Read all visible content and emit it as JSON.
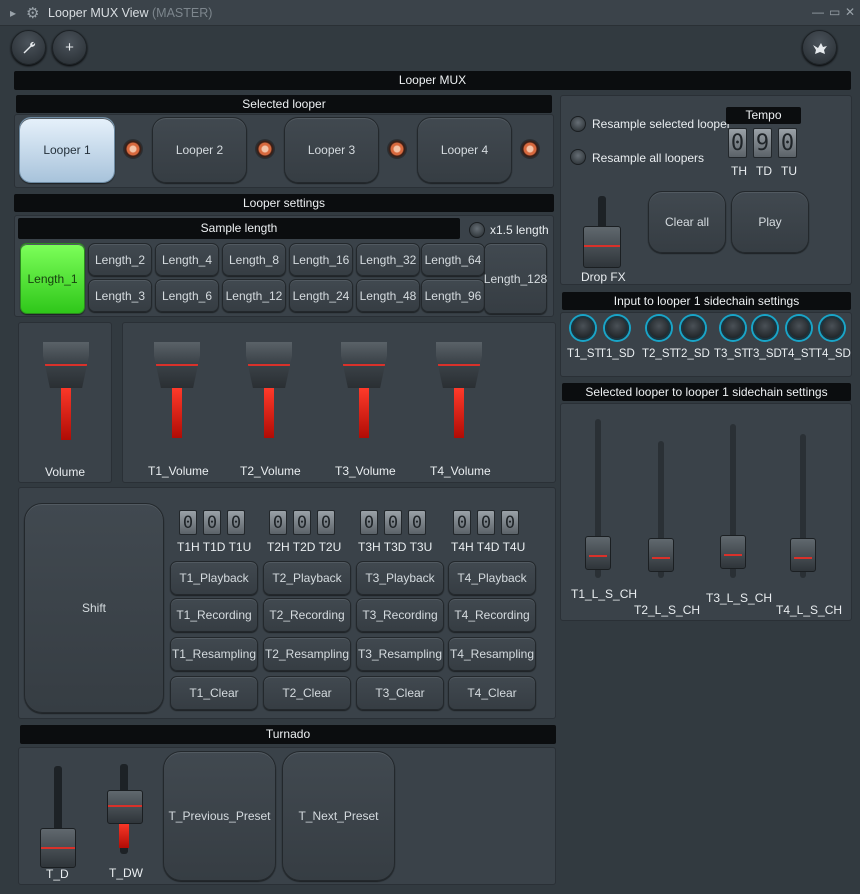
{
  "window": {
    "title": "Looper MUX View",
    "title_suffix": "(MASTER)",
    "controls": {
      "minimize": "—",
      "maximize": "▭",
      "close": "✕"
    }
  },
  "toolbar": {
    "wrench_icon": "wrench-icon",
    "plus_icon": "plus-icon",
    "pegasus_icon": "pegasus-icon"
  },
  "main_header": "Looper MUX",
  "selected_looper": {
    "header": "Selected looper",
    "loopers": [
      "Looper 1",
      "Looper 2",
      "Looper 3",
      "Looper 4"
    ],
    "selected": "Looper 1"
  },
  "looper_settings": {
    "header": "Looper settings",
    "sample_length_header": "Sample length",
    "x15_label": "x1.5 length",
    "lengths_top": [
      "Length_2",
      "Length_4",
      "Length_8",
      "Length_16",
      "Length_32",
      "Length_64"
    ],
    "lengths_bottom": [
      "Length_3",
      "Length_6",
      "Length_12",
      "Length_24",
      "Length_48",
      "Length_96"
    ],
    "length_1": "Length_1",
    "length_128": "Length_128",
    "active_length": "Length_1"
  },
  "volumes": {
    "master_label": "Volume",
    "master_level": 0.55,
    "tracks": [
      {
        "label": "T1_Volume",
        "level": 0.5
      },
      {
        "label": "T2_Volume",
        "level": 0.5
      },
      {
        "label": "T3_Volume",
        "level": 0.5
      },
      {
        "label": "T4_Volume",
        "level": 0.5
      }
    ]
  },
  "track_controls": {
    "shift": "Shift",
    "counters": [
      {
        "digits": [
          "0",
          "0",
          "0"
        ],
        "label": "T1H T1D T1U"
      },
      {
        "digits": [
          "0",
          "0",
          "0"
        ],
        "label": "T2H T2D T2U"
      },
      {
        "digits": [
          "0",
          "0",
          "0"
        ],
        "label": "T3H T3D T3U"
      },
      {
        "digits": [
          "0",
          "0",
          "0"
        ],
        "label": "T4H T4D T4U"
      }
    ],
    "playback": [
      "T1_Playback",
      "T2_Playback",
      "T3_Playback",
      "T4_Playback"
    ],
    "recording": [
      "T1_Recording",
      "T2_Recording",
      "T3_Recording",
      "T4_Recording"
    ],
    "resampling": [
      "T1_Resampling",
      "T2_Resampling",
      "T3_Resampling",
      "T4_Resampling"
    ],
    "clear": [
      "T1_Clear",
      "T2_Clear",
      "T3_Clear",
      "T4_Clear"
    ]
  },
  "turnado": {
    "header": "Turnado",
    "t_d_label": "T_D",
    "t_dw_label": "T_DW",
    "t_dw_level": 0.3,
    "previous_preset": "T_Previous_Preset",
    "next_preset": "T_Next_Preset"
  },
  "resample": {
    "selected_label": "Resample selected looper",
    "all_label": "Resample all loopers",
    "tempo_header": "Tempo",
    "tempo_digits": [
      "0",
      "9",
      "0"
    ],
    "tempo_labels": [
      "TH",
      "TD",
      "TU"
    ],
    "drop_fx": "Drop FX",
    "clear_all": "Clear all",
    "play": "Play"
  },
  "sidechain_input": {
    "header": "Input to looper 1 sidechain settings",
    "knob_labels": [
      "T1_ST",
      "T1_SD",
      "T2_ST",
      "T2_SD",
      "T3_ST",
      "T3_SD",
      "T4_ST",
      "T4_SD"
    ]
  },
  "sidechain_selected": {
    "header": "Selected looper to looper 1 sidechain settings",
    "sliders": [
      {
        "label": "T1_L_S_CH",
        "level": 0.18
      },
      {
        "label": "T2_L_S_CH",
        "level": 0.1
      },
      {
        "label": "T3_L_S_CH",
        "level": 0.2
      },
      {
        "label": "T4_L_S_CH",
        "level": 0.1
      }
    ]
  },
  "colors": {
    "accent_green": "#3fe021",
    "fader_red": "#ff2a1a",
    "knob_ring": "#19a5c8",
    "selected_blue": "#c8dcef"
  }
}
